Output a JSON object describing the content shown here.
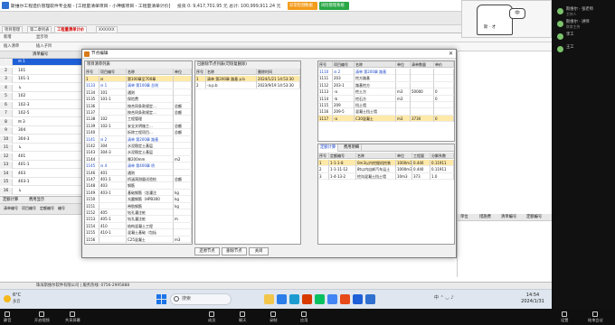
{
  "titlebar": {
    "title": "斯维尔工程造价管理软件专业版 - [工程量清单项目 - 小神版项目 - 工程量清单计价]",
    "amount_text": "投资 0: 9,417,701.95 元    总计: 100,999,911.24 元",
    "buttons": [
      "异常检测数据",
      "风险管理系统"
    ],
    "controls": "— □ ✕"
  },
  "ribbon_tabs": [
    "项目管理",
    "第二章列表",
    "工程量清单计价",
    "XXXXXX"
  ],
  "toolbar": {
    "items": [
      "新增",
      "显示项"
    ],
    "row2": [
      "插入清单",
      "插入子目"
    ],
    "dropdown": "新增工程量清单定额(2016)",
    "right_buttons": [
      "定额操作",
      "清单编号",
      "清单库",
      "定额库",
      "展开",
      "查找",
      "显示设置"
    ]
  },
  "left_grid": {
    "header": "清单编号",
    "rows": [
      {
        "num": "1",
        "code": "⊟ 1"
      },
      {
        "num": "2",
        "code": "101"
      },
      {
        "num": "3",
        "code": "101-1"
      },
      {
        "num": "4",
        "code": "↳"
      },
      {
        "num": "5",
        "code": "102"
      },
      {
        "num": "6",
        "code": "102-3"
      },
      {
        "num": "7",
        "code": "102-5"
      },
      {
        "num": "8",
        "code": "⊟ 3"
      },
      {
        "num": "9",
        "code": "304"
      },
      {
        "num": "10",
        "code": "304-3"
      },
      {
        "num": "11",
        "code": "↳"
      },
      {
        "num": "12",
        "code": "401"
      },
      {
        "num": "13",
        "code": "401-1"
      },
      {
        "num": "14",
        "code": "403"
      },
      {
        "num": "15",
        "code": "403-1"
      },
      {
        "num": "16",
        "code": "↳"
      }
    ]
  },
  "bottom_left": {
    "tabs": [
      "定额计算",
      "费用显示"
    ],
    "headers": [
      "清单编号",
      "项目编号",
      "定额编号",
      "编号"
    ]
  },
  "right_area": {
    "headers": [
      "单位",
      "措施费",
      "清单编号",
      "定额编号"
    ]
  },
  "statusbar": "珠海斯维尔软件有限公司  |  服务热线: 0756-2995888",
  "dialog": {
    "title": "节点编辑",
    "left_panel": {
      "label": "项目清单列表",
      "headers": [
        "序号",
        "项目编号",
        "名称",
        "单位"
      ],
      "rows": [
        [
          "1",
          "⊟",
          "第100章至700章",
          ""
        ],
        [
          "1133",
          "⊟ 1",
          "清单 第100章 总则",
          ""
        ],
        [
          "1134",
          "101",
          "通则",
          ""
        ],
        [
          "1135",
          "101-1",
          "保险费",
          ""
        ],
        [
          "1136",
          "",
          "按合同条款规定…",
          "总额"
        ],
        [
          "1137",
          "",
          "按合同条款规定…",
          "总额"
        ],
        [
          "1138",
          "102",
          "工程管理",
          ""
        ],
        [
          "1139",
          "102-1",
          "安全文明施工…",
          "总额"
        ],
        [
          "1140",
          "",
          "拆除工程项目…",
          "总额"
        ],
        [
          "1141",
          "⊟ 2",
          "清单 第200章 路基",
          ""
        ],
        [
          "1142",
          "304",
          "水泥稳定土基层",
          ""
        ],
        [
          "1143",
          "304-3",
          "水泥稳定土基层",
          ""
        ],
        [
          "1144",
          "",
          "厚200mm",
          "m2"
        ],
        [
          "1145",
          "⊟ 4",
          "清单 第400章 桥",
          ""
        ],
        [
          "1146",
          "401",
          "通则",
          ""
        ],
        [
          "1147",
          "401-1",
          "桥涵洞测量试验检",
          "总额"
        ],
        [
          "1148",
          "403",
          "钢筋",
          ""
        ],
        [
          "1149",
          "403-1",
          "基础钢筋（含灌注",
          "kg"
        ],
        [
          "1150",
          "",
          "光圆钢筋（HPB300",
          "kg"
        ],
        [
          "1151",
          "",
          "带肋钢筋",
          "kg"
        ],
        [
          "1152",
          "405",
          "钻孔灌注桩",
          ""
        ],
        [
          "1153",
          "405-1",
          "钻孔灌注桩",
          "m"
        ],
        [
          "1154",
          "410",
          "结构混凝土工程",
          ""
        ],
        [
          "1155",
          "410-1",
          "混凝土基础（包括",
          ""
        ],
        [
          "1156",
          "",
          "C25混凝土",
          "m3"
        ]
      ]
    },
    "mid_panel": {
      "label": "已删除节点列表(可恢复删除)",
      "headers": [
        "序号",
        "名称",
        "删除时间"
      ],
      "rows": [
        [
          "1",
          "清单 第200章 路基 p.b",
          "2024/1/21 14:53:30"
        ],
        [
          "2",
          "-a.p.b",
          "2023/9/19 14:53:30"
        ]
      ]
    },
    "right_panel": {
      "headers": [
        "序号",
        "项目编号",
        "名称",
        "单位",
        "清单数量",
        "单价"
      ],
      "rows": [
        [
          "1110",
          "⊟ 2",
          "清单 第200章 路基",
          "",
          "",
          ""
        ],
        [
          "1111",
          "203",
          "挖方路基",
          "",
          "",
          ""
        ],
        [
          "1112",
          "203-1",
          "路基挖方",
          "",
          "",
          ""
        ],
        [
          "1113",
          "-a",
          "挖土方",
          "m3",
          "50000",
          "0"
        ],
        [
          "1114",
          "-b",
          "挖石方",
          "m3",
          "",
          "0"
        ],
        [
          "1115",
          "209",
          "挡土墙",
          "",
          "",
          ""
        ],
        [
          "1116",
          "209-5",
          "混凝土挡土墙",
          "",
          "",
          ""
        ],
        [
          "1117",
          "-a",
          "C30混凝土",
          "m3",
          "3730",
          "0"
        ]
      ]
    },
    "bottom_right": {
      "tabs": [
        "定额计算",
        "费用明细"
      ],
      "headers": [
        "序号",
        "定额编号",
        "名称",
        "单位",
        "工程量",
        "分解系数"
      ],
      "rows": [
        [
          "1",
          "1-1-1-8",
          "0m3以内挖掘机挖装",
          "1000m3",
          "0.440",
          "0.11911"
        ],
        [
          "2",
          "1-1-11-12",
          "8t以内自卸汽车运土",
          "1000m3",
          "0.440",
          "0.11911"
        ],
        [
          "3",
          "1-4-13-2",
          "挖沟混凝土挡土墙",
          "10m3",
          "373",
          "1.0"
        ]
      ]
    },
    "buttons": [
      "还原节点",
      "删除节点",
      "关闭"
    ]
  },
  "webcam": {
    "bubble": "中",
    "caption": "斯 · 才"
  },
  "taskbar": {
    "weather_temp": "6°C",
    "weather_desc": "多云",
    "search_placeholder": "搜索",
    "tray_text": "中  ⌃  ◡  ♪",
    "time": "14:54",
    "date": "2024/1/31"
  },
  "meeting": {
    "participants": [
      {
        "name": "斯维尔 · 张老师",
        "sub": "主持人"
      },
      {
        "name": "斯维尔 · 讲师",
        "sub": "联席主持"
      },
      {
        "name": "李工",
        "sub": ""
      },
      {
        "name": "王工",
        "sub": ""
      }
    ]
  },
  "bottom_bar": [
    "静音",
    "开启视频",
    "共享屏幕",
    "成员",
    "聊天",
    "录制",
    "应用",
    "设置",
    "结束会议"
  ]
}
